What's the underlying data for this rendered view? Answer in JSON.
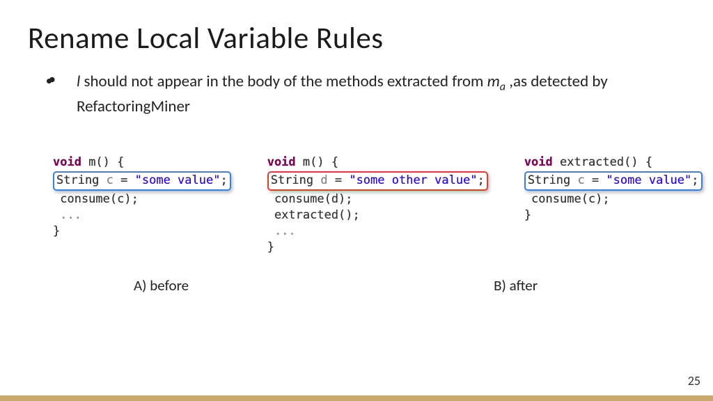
{
  "title": "Rename Local Variable Rules",
  "bullet": {
    "l": "l",
    "text1": " should not appear in the body of the methods extracted from ",
    "m": "m",
    "sub": "a",
    "text2": " ,as detected by RefactoringMiner"
  },
  "code": {
    "before": {
      "l1a": "void",
      "l1b": " m() {",
      "l2a": "String ",
      "l2b": "c",
      "l2c": " = ",
      "l2d": "\"some value\"",
      "l2e": ";",
      "l3": " consume(c);",
      "l4": " ...",
      "l5": "}"
    },
    "after_m": {
      "l1a": "void",
      "l1b": " m() {",
      "l2a": "String ",
      "l2b": "d",
      "l2c": " = ",
      "l2d": "\"some other value\"",
      "l2e": ";",
      "l3": " consume(d);",
      "l4": " extracted();",
      "l5": " ...",
      "l6": "}"
    },
    "after_ex": {
      "l1a": "void",
      "l1b": " extracted() {",
      "l2a": "String ",
      "l2b": "c",
      "l2c": " = ",
      "l2d": "\"some value\"",
      "l2e": ";",
      "l3": " consume(c);",
      "l4": "}"
    }
  },
  "captions": {
    "a": "A) before",
    "b": "B) after"
  },
  "page": "25"
}
